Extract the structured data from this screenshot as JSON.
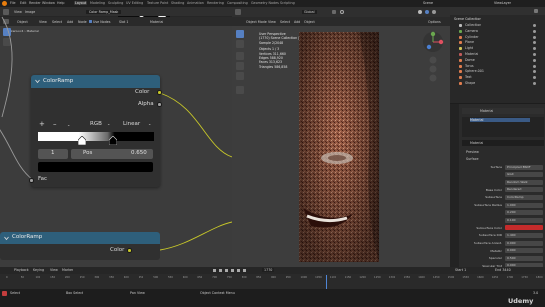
{
  "menu": [
    "File",
    "Edit",
    "Render",
    "Window",
    "Help"
  ],
  "workspace_tabs": [
    "Layout",
    "Modeling",
    "Sculpting",
    "UV Editing",
    "Texture Paint",
    "Shading",
    "Animation",
    "Rendering",
    "Compositing",
    "Geometry Nodes",
    "Scripting"
  ],
  "active_tab": "Layout",
  "scene_name": "Scene",
  "view_layer_name": "ViewLayer",
  "image_editor": {
    "menus": [
      "View",
      "Image"
    ],
    "image_name": "Color Ramp_Mask"
  },
  "node_editor": {
    "header": [
      "Object",
      "View",
      "Select",
      "Add",
      "Node"
    ],
    "use_nodes_label": "Use Nodes",
    "slot": "Slot 1",
    "material": "Material",
    "breadcrumb": [
      "BrokenLoc4",
      "Material"
    ]
  },
  "color_ramp_node": {
    "title": "ColorRamp",
    "outputs": [
      "Color",
      "Alpha"
    ],
    "color_mode": "RGB",
    "interpolation": "Linear",
    "add_sign": "+",
    "remove_sign": "–",
    "stop_index": "1",
    "pos_label": "Pos",
    "pos_value": "0.650",
    "input": "Fac"
  },
  "color_ramp_node_2": {
    "title": "ColorRamp",
    "output": "Color"
  },
  "viewport": {
    "header": [
      "Object Mode",
      "View",
      "Select",
      "Add",
      "Object"
    ],
    "transform": "Global",
    "stats": [
      "User Perspective",
      "(1770) Scene Collection | Material",
      "Sample 2/2048",
      "Objects   1 / 3",
      "Vertices  311,660",
      "Edges     588,920",
      "Faces     313,623",
      "Triangles 586,858"
    ],
    "options_label": "Options"
  },
  "outliner": {
    "title": "Scene Collection",
    "items": [
      "Collection",
      "Camera",
      "Cylinder",
      "Plane",
      "Light",
      "Material",
      "Dome",
      "Torus",
      "Sphere.001",
      "Text",
      "Shape"
    ]
  },
  "properties": {
    "object_name": "Material",
    "slot": "Material",
    "sections": [
      "Preview",
      "Surface"
    ],
    "rows": [
      {
        "label": "Surface",
        "value": "Principled BSDF"
      },
      {
        "label": "",
        "value": "GGX"
      },
      {
        "label": "",
        "value": "Random Walk"
      },
      {
        "label": "Base Color",
        "value": "Rendered"
      },
      {
        "label": "Subsurface",
        "value": "ColorRamp"
      },
      {
        "label": "Subsurface Radius",
        "value": "1.000"
      },
      {
        "label": "",
        "value": "0.200"
      },
      {
        "label": "",
        "value": "0.100"
      },
      {
        "label": "Subsurface Color",
        "value": ""
      },
      {
        "label": "Subsurface IOR",
        "value": "1.400"
      },
      {
        "label": "Subsurface Anisot.",
        "value": "0.000"
      },
      {
        "label": "Metallic",
        "value": "0.000"
      },
      {
        "label": "Specular",
        "value": "0.500"
      },
      {
        "label": "Specular Tint",
        "value": "0.000"
      },
      {
        "label": "Roughness",
        "value": "ColorRamp"
      }
    ]
  },
  "timeline": {
    "menus": [
      "Playback",
      "Keying",
      "View",
      "Marker"
    ],
    "current_frame": "1770",
    "ticks": [
      "0",
      "50",
      "100",
      "150",
      "200",
      "250",
      "300",
      "350",
      "400",
      "450",
      "500",
      "550",
      "600",
      "650",
      "700",
      "750",
      "800",
      "850",
      "900",
      "950",
      "1000",
      "1050",
      "1100",
      "1150",
      "1200",
      "1250",
      "1300",
      "1350",
      "1400",
      "1450",
      "1500",
      "1550",
      "1600",
      "1650",
      "1700",
      "1750",
      "1800"
    ],
    "start": "Start 1",
    "end": "End 3440"
  },
  "statusbar": {
    "left": "Select",
    "mid": "Box Select",
    "mid2": "Pan View",
    "right": "Object Context Menu",
    "version": "3.0"
  },
  "watermark": "Udemy",
  "colors": {
    "node_header": "#2e5f7b",
    "socket_yellow": "#c7c729",
    "socket_gray": "#a1a1a1",
    "accent_blue": "#5680c2",
    "subsurface_color": "#c42b2b",
    "skin": "#9a5b44"
  }
}
